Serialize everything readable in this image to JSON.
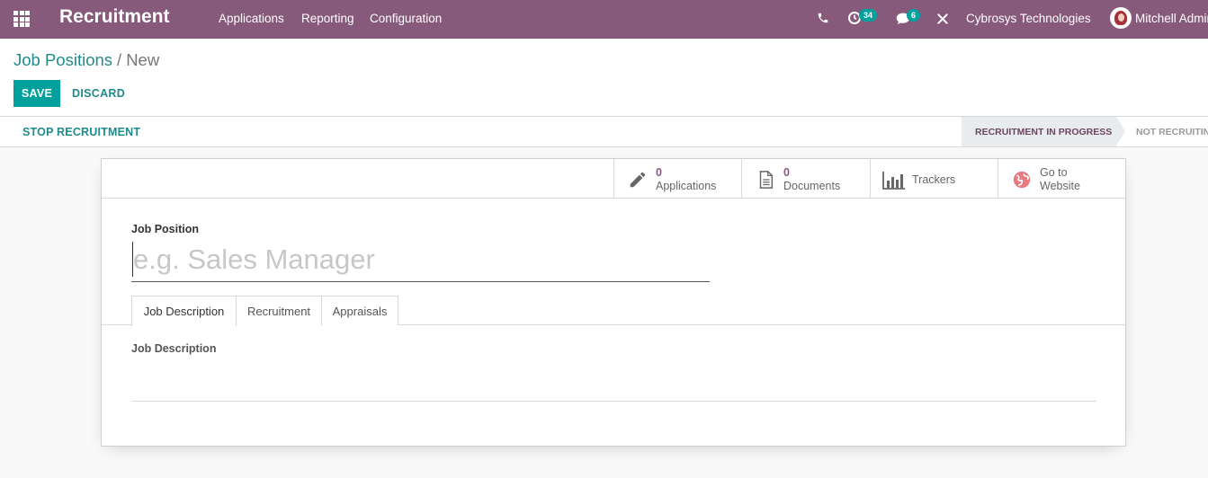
{
  "navbar": {
    "app_name": "Recruitment",
    "menu": [
      "Applications",
      "Reporting",
      "Configuration"
    ],
    "activity_badge": "34",
    "messages_badge": "6",
    "company": "Cybrosys Technologies",
    "user": "Mitchell Admin"
  },
  "breadcrumb": {
    "parent": "Job Positions",
    "separator": "/",
    "current": "New"
  },
  "actions": {
    "save": "SAVE",
    "discard": "DISCARD"
  },
  "statusbar": {
    "stop_button": "STOP RECRUITMENT",
    "stages": [
      "RECRUITMENT IN PROGRESS",
      "NOT RECRUITING"
    ],
    "active_stage": "RECRUITMENT IN PROGRESS"
  },
  "smart_buttons": {
    "applications": {
      "value": "0",
      "label": "Applications"
    },
    "documents": {
      "value": "0",
      "label": "Documents"
    },
    "trackers": {
      "label": "Trackers"
    },
    "website": {
      "label1": "Go to",
      "label2": "Website"
    }
  },
  "form": {
    "job_position_label": "Job Position",
    "job_position_placeholder": "e.g. Sales Manager",
    "job_position_value": "",
    "tabs": [
      "Job Description",
      "Recruitment",
      "Appraisals"
    ],
    "active_tab": "Job Description",
    "description_label": "Job Description"
  },
  "colors": {
    "navbar": "#875a7b",
    "primary": "#00a09d",
    "link": "#1f8b8b"
  }
}
